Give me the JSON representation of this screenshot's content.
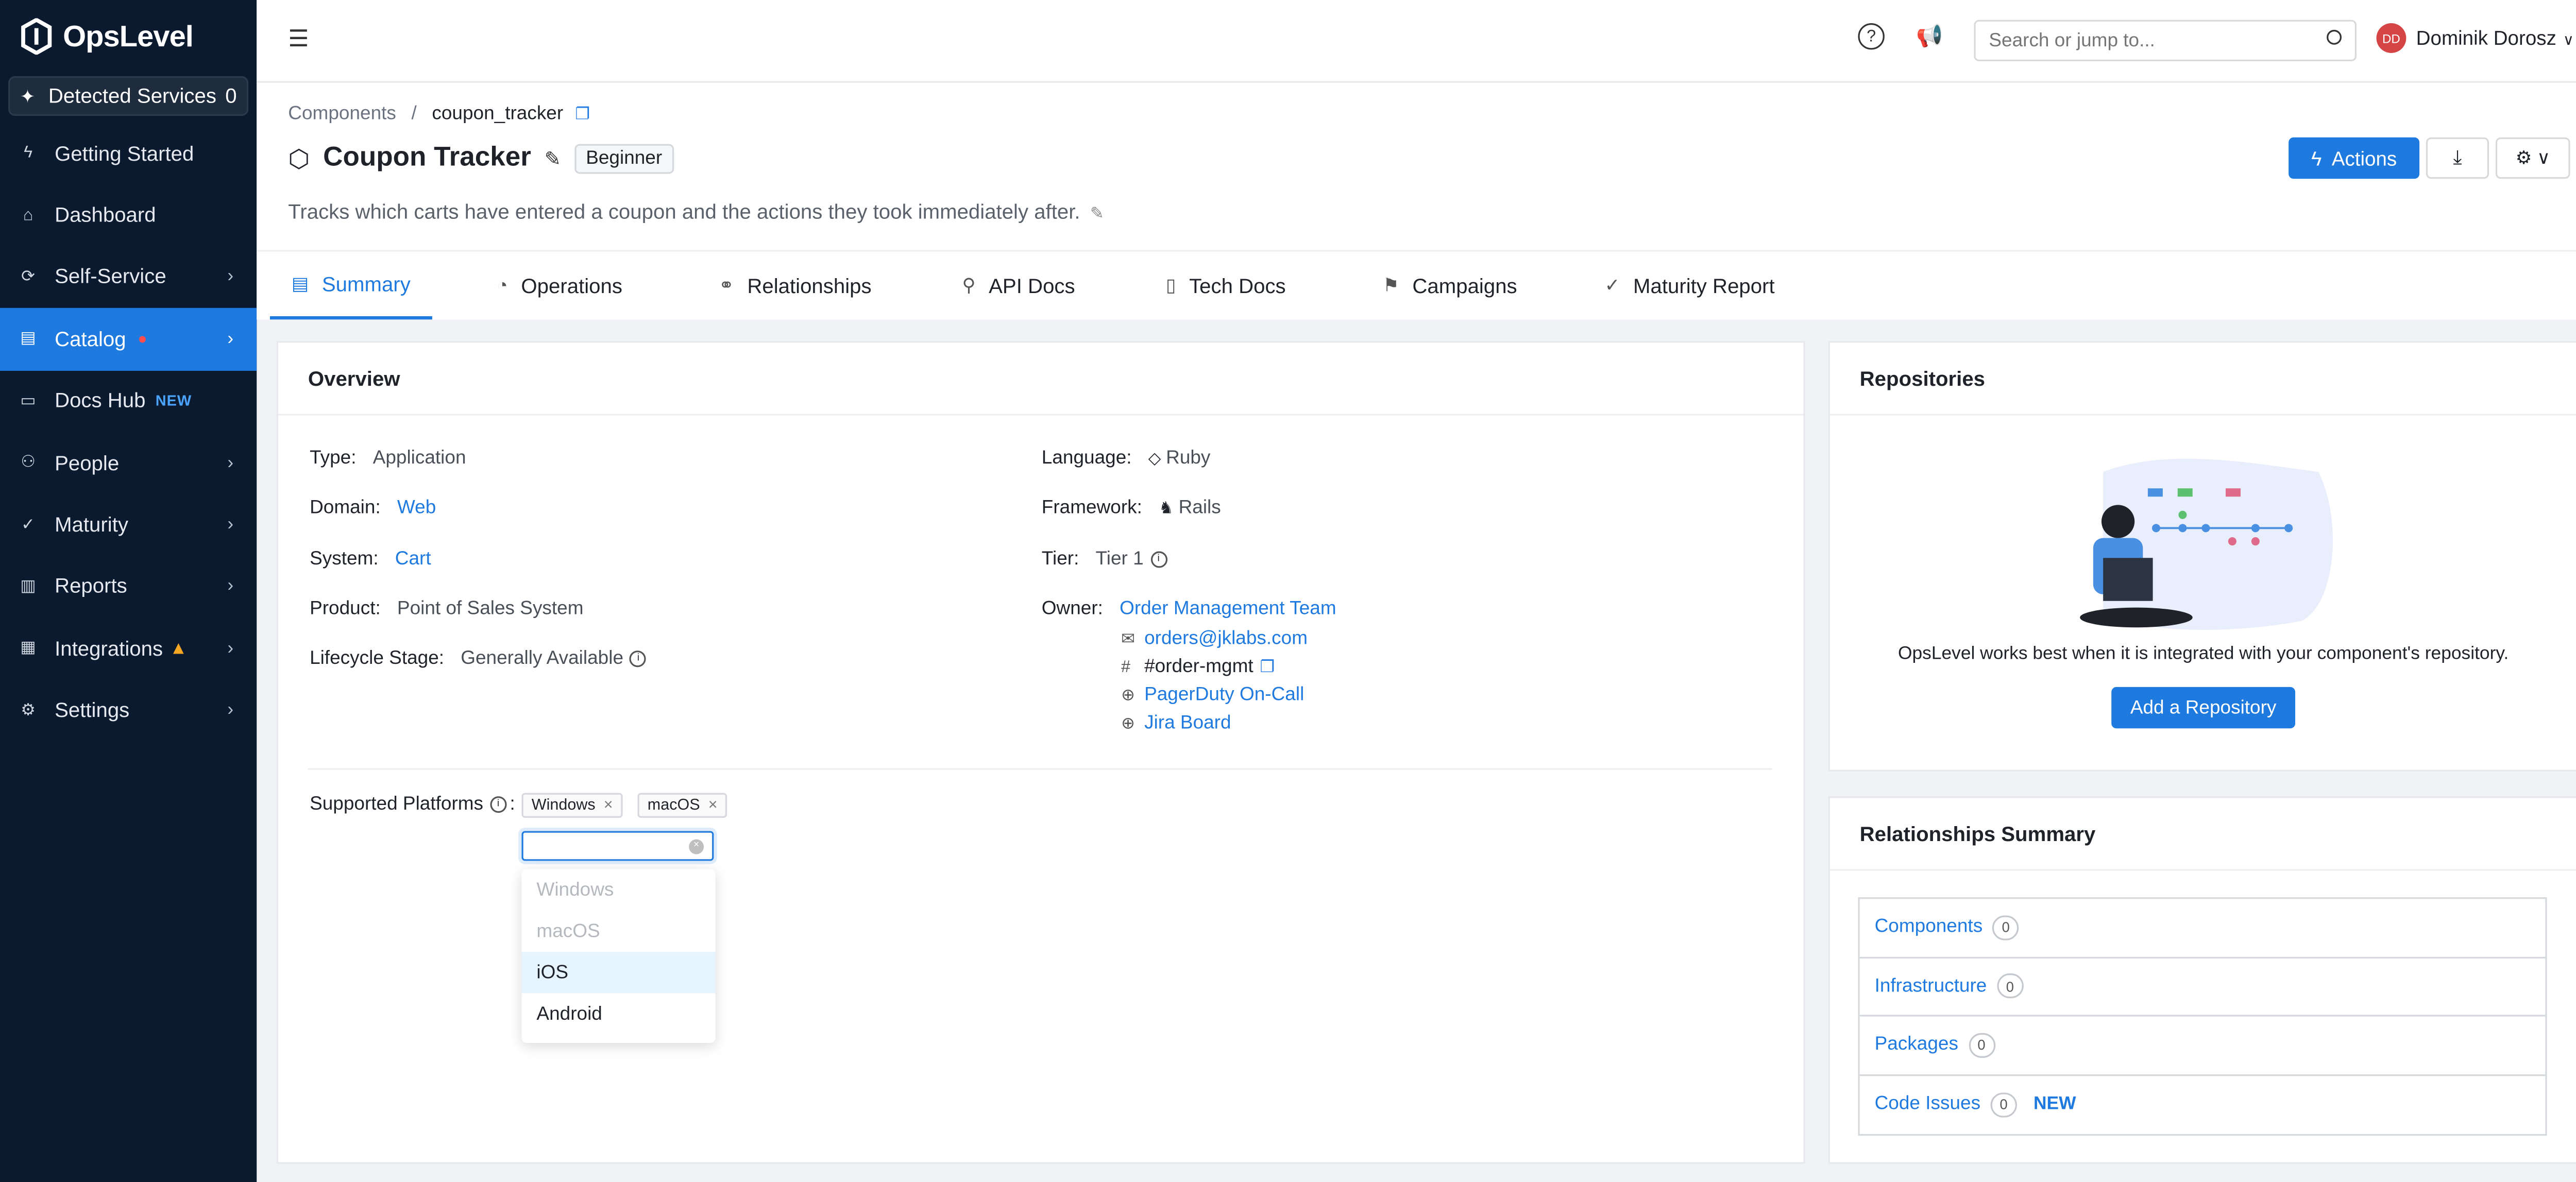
{
  "app": {
    "name": "OpsLevel"
  },
  "sidebar": {
    "detected": {
      "label": "Detected Services",
      "count": "0"
    },
    "items": [
      {
        "label": "Getting Started",
        "icon": "bolt-icon"
      },
      {
        "label": "Dashboard",
        "icon": "home-icon"
      },
      {
        "label": "Self-Service",
        "icon": "sync-icon"
      },
      {
        "label": "Catalog",
        "icon": "book-icon"
      },
      {
        "label": "Docs Hub",
        "icon": "docs-icon",
        "tag": "NEW"
      },
      {
        "label": "People",
        "icon": "people-icon"
      },
      {
        "label": "Maturity",
        "icon": "check-circle-icon"
      },
      {
        "label": "Reports",
        "icon": "chart-icon"
      },
      {
        "label": "Integrations",
        "icon": "grid-icon"
      },
      {
        "label": "Settings",
        "icon": "gear-icon"
      }
    ]
  },
  "topbar": {
    "search_placeholder": "Search or jump to...",
    "user_initials": "DD",
    "user_name": "Dominik Dorosz"
  },
  "header": {
    "breadcrumb_root": "Components",
    "breadcrumb_sep": "/",
    "breadcrumb_current": "coupon_tracker",
    "title": "Coupon Tracker",
    "level": "Beginner",
    "description": "Tracks which carts have entered a coupon and the actions they took immediately after.",
    "actions_label": "Actions"
  },
  "tabs": [
    "Summary",
    "Operations",
    "Relationships",
    "API Docs",
    "Tech Docs",
    "Campaigns",
    "Maturity Report"
  ],
  "overview": {
    "title": "Overview",
    "type_k": "Type",
    "type_v": "Application",
    "domain_k": "Domain",
    "domain_v": "Web",
    "system_k": "System",
    "system_v": "Cart",
    "product_k": "Product",
    "product_v": "Point of Sales System",
    "lifecycle_k": "Lifecycle Stage",
    "lifecycle_v": "Generally Available",
    "language_k": "Language",
    "language_v": "Ruby",
    "framework_k": "Framework",
    "framework_v": "Rails",
    "tier_k": "Tier",
    "tier_v": "Tier 1",
    "owner_k": "Owner",
    "owner_v": "Order Management Team",
    "owner_email": "orders@jklabs.com",
    "owner_slack": "#order-mgmt",
    "owner_pager": "PagerDuty On-Call",
    "owner_jira": "Jira Board",
    "platforms_k": "Supported Platforms",
    "platforms_selected": [
      "Windows",
      "macOS"
    ],
    "platform_options": [
      {
        "label": "Windows",
        "state": "disabled"
      },
      {
        "label": "macOS",
        "state": "disabled"
      },
      {
        "label": "iOS",
        "state": "highlighted"
      },
      {
        "label": "Android",
        "state": "normal"
      }
    ]
  },
  "repositories": {
    "title": "Repositories",
    "text": "OpsLevel works best when it is integrated with your component's repository.",
    "button": "Add a Repository"
  },
  "relationships": {
    "title": "Relationships Summary",
    "rows": [
      {
        "label": "Components",
        "count": "0"
      },
      {
        "label": "Infrastructure",
        "count": "0"
      },
      {
        "label": "Packages",
        "count": "0"
      },
      {
        "label": "Code Issues",
        "count": "0",
        "tag": "NEW"
      }
    ]
  }
}
